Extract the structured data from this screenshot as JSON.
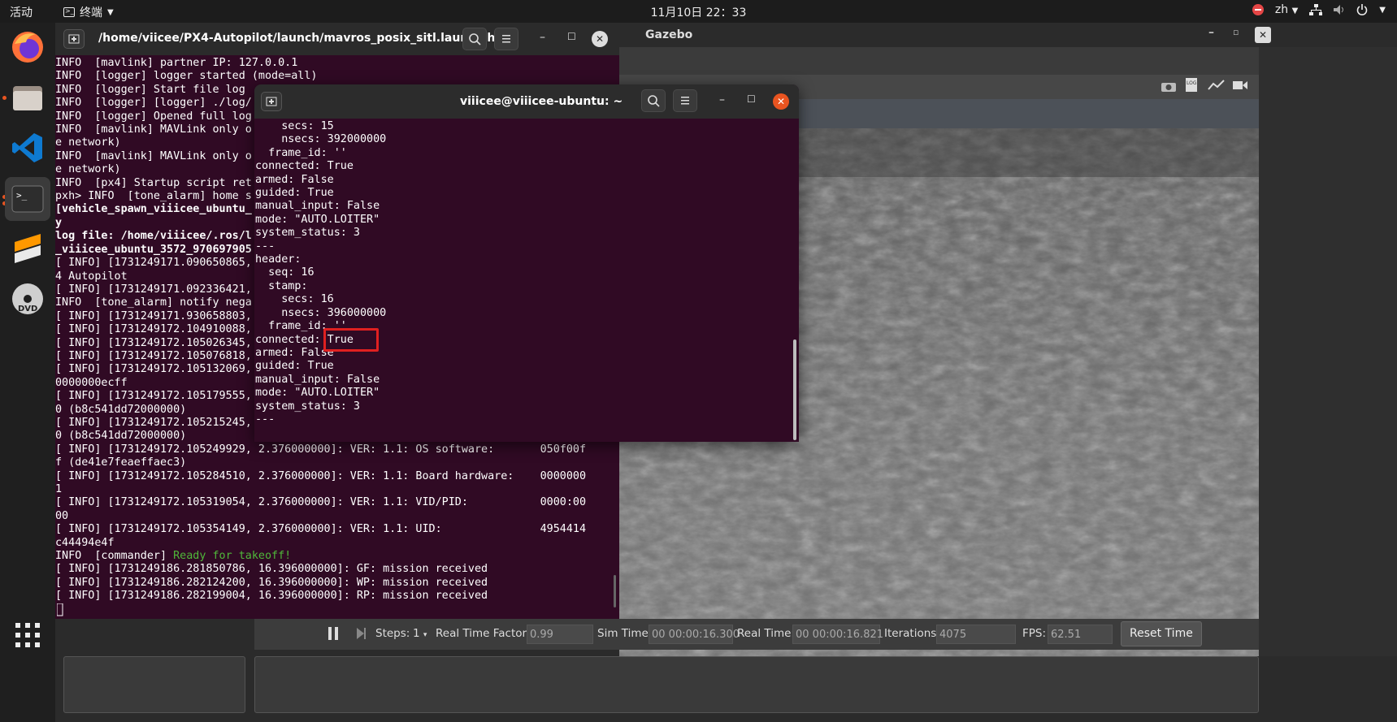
{
  "topbar": {
    "activities": "活动",
    "app_name": "终端",
    "clock": "11月10日  22：33",
    "lang": "zh"
  },
  "dock": {
    "items": [
      "firefox-icon",
      "files-icon",
      "vscode-icon",
      "terminal-icon",
      "sublime-icon",
      "dvd-icon",
      "app-grid-icon"
    ]
  },
  "terminal_back": {
    "title": "/home/viicee/PX4-Autopilot/launch/mavros_posix_sitl.launch h...",
    "lines": [
      "INFO  [mavlink] partner IP: 127.0.0.1",
      "INFO  [logger] logger started (mode=all)",
      "INFO  [logger] Start file log",
      "INFO  [logger] [logger] ./log/",
      "INFO  [logger] Opened full log",
      "INFO  [mavlink] MAVLink only o",
      "e network)",
      "INFO  [mavlink] MAVLink only o",
      "e network)",
      "INFO  [px4] Startup script ret",
      "pxh> INFO  [tone_alarm] home s",
      "[vehicle_spawn_viiicee_ubuntu_",
      "y",
      "log file: /home/viiicee/.ros/l",
      "_viiicee_ubuntu_3572_970697905",
      "[ INFO] [1731249171.090650865,",
      "4 Autopilot",
      "[ INFO] [1731249171.092336421,",
      "INFO  [tone_alarm] notify nega",
      "[ INFO] [1731249171.930658803,",
      "[ INFO] [1731249172.104910088,",
      "[ INFO] [1731249172.105026345,",
      "[ INFO] [1731249172.105076818,",
      "[ INFO] [1731249172.105132069,",
      "0000000ecff",
      "[ INFO] [1731249172.105179555,",
      "0 (b8c541dd72000000)",
      "[ INFO] [1731249172.105215245,",
      "0 (b8c541dd72000000)",
      "[ INFO] [1731249172.105249929, 2.376000000]: VER: 1.1: OS software:       050f00f",
      "f (de41e7feaeffaec3)",
      "[ INFO] [1731249172.105284510, 2.376000000]: VER: 1.1: Board hardware:    0000000",
      "1",
      "[ INFO] [1731249172.105319054, 2.376000000]: VER: 1.1: VID/PID:           0000:00",
      "00",
      "[ INFO] [1731249172.105354149, 2.376000000]: VER: 1.1: UID:               4954414",
      "c44494e4f"
    ],
    "commander_prefix": "INFO  [commander] ",
    "commander_msg": "Ready for takeoff!",
    "tail_lines": [
      "[ INFO] [1731249186.281850786, 16.396000000]: GF: mission received",
      "[ INFO] [1731249186.282124200, 16.396000000]: WP: mission received",
      "[ INFO] [1731249186.282199004, 16.396000000]: RP: mission received"
    ]
  },
  "terminal_front": {
    "title": "viiicee@viiicee-ubuntu: ~",
    "lines": [
      "    secs: 15",
      "    nsecs: 392000000",
      "  frame_id: ''",
      "connected: True",
      "armed: False",
      "guided: True",
      "manual_input: False",
      "mode: \"AUTO.LOITER\"",
      "system_status: 3",
      "---",
      "header:",
      "  seq: 16",
      "  stamp:",
      "    secs: 16",
      "    nsecs: 396000000",
      "  frame_id: ''",
      "connected: True",
      "armed: False",
      "guided: True",
      "manual_input: False",
      "mode: \"AUTO.LOITER\"",
      "system_status: 3",
      "---"
    ]
  },
  "gazebo": {
    "title": "Gazebo",
    "status": {
      "steps_label": "Steps:",
      "steps_value": "1",
      "rtf_label": "Real Time Factor:",
      "rtf_value": "0.99",
      "sim_label": "Sim Time:",
      "sim_value": "00 00:00:16.300",
      "real_label": "Real Time:",
      "real_value": "00 00:00:16.821",
      "iter_label": "Iterations:",
      "iter_value": "4075",
      "fps_label": "FPS:",
      "fps_value": "62.51",
      "reset_label": "Reset Time"
    }
  },
  "colors": {
    "terminal_bg": "#300a24",
    "close_orange": "#e95420",
    "highlight_red": "#e02020",
    "ready_green": "#4fb83a"
  }
}
